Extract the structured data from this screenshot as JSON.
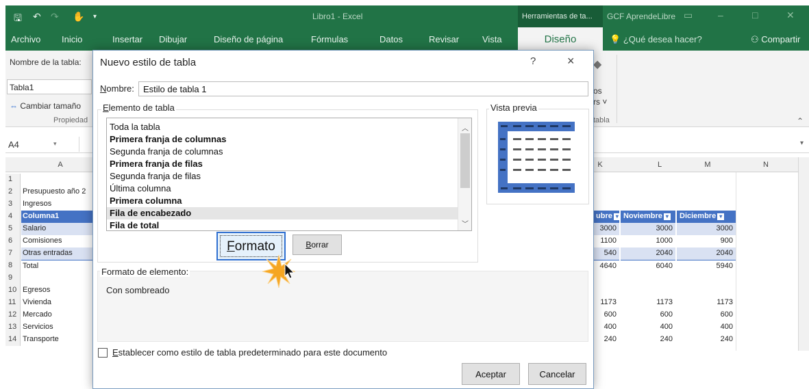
{
  "excel": {
    "document_title": "Libro1 - Excel",
    "context_tab": "Herramientas de ta...",
    "brand": "GCF AprendeLibre",
    "tabs": [
      "Archivo",
      "Inicio",
      "Insertar",
      "Dibujar",
      "Diseño de página",
      "Fórmulas",
      "Datos",
      "Revisar",
      "Vista"
    ],
    "active_tab": "Diseño",
    "tell_me": "¿Qué desea hacer?",
    "share": "Compartir",
    "ribbon": {
      "table_name_label": "Nombre de la tabla:",
      "table_name_value": "Tabla1",
      "resize_label": "Cambiar tamaño",
      "group_label": "Propiedad",
      "styles_group": "tabla",
      "partial_1": "os",
      "partial_2": "rs ˅"
    },
    "name_box": "A4",
    "columns": [
      "A",
      "K",
      "L",
      "M",
      "N"
    ],
    "rows": [
      {
        "n": "1",
        "a": ""
      },
      {
        "n": "2",
        "a": "Presupuesto año 2"
      },
      {
        "n": "3",
        "a": "Ingresos"
      },
      {
        "n": "4",
        "a": "Columna1"
      },
      {
        "n": "5",
        "a": "Salario"
      },
      {
        "n": "6",
        "a": "Comisiones"
      },
      {
        "n": "7",
        "a": "Otras entradas"
      },
      {
        "n": "8",
        "a": "Total"
      },
      {
        "n": "9",
        "a": ""
      },
      {
        "n": "10",
        "a": "Egresos"
      },
      {
        "n": "11",
        "a": "Vivienda"
      },
      {
        "n": "12",
        "a": "Mercado"
      },
      {
        "n": "13",
        "a": "Servicios"
      },
      {
        "n": "14",
        "a": "Transporte"
      }
    ],
    "right_headers": [
      "ubre",
      "Noviembre",
      "Diciembre"
    ],
    "right_values": [
      [
        "3000",
        "3000",
        "3000"
      ],
      [
        "1100",
        "1000",
        "900"
      ],
      [
        "540",
        "2040",
        "2040"
      ],
      [
        "4640",
        "6040",
        "5940"
      ],
      [
        "",
        "",
        ""
      ],
      [
        "",
        "",
        ""
      ],
      [
        "1173",
        "1173",
        "1173"
      ],
      [
        "600",
        "600",
        "600"
      ],
      [
        "400",
        "400",
        "400"
      ],
      [
        "240",
        "240",
        "240"
      ]
    ]
  },
  "dialog": {
    "title": "Nuevo estilo de tabla",
    "help": "?",
    "close": "×",
    "name_label_first": "N",
    "name_label_rest": "ombre:",
    "name_value": "Estilo de tabla 1",
    "element_label_first": "E",
    "element_label_rest": "lemento de tabla",
    "preview_label": "Vista previa",
    "elements": [
      {
        "label": "Toda la tabla",
        "bold": false
      },
      {
        "label": "Primera franja de columnas",
        "bold": true
      },
      {
        "label": "Segunda franja de columnas",
        "bold": false
      },
      {
        "label": "Primera franja de filas",
        "bold": true
      },
      {
        "label": "Segunda franja de filas",
        "bold": false
      },
      {
        "label": "Última columna",
        "bold": false
      },
      {
        "label": "Primera columna",
        "bold": true
      },
      {
        "label": "Fila de encabezado",
        "bold": true
      },
      {
        "label": "Fila de total",
        "bold": true
      }
    ],
    "selected_element": "Fila de encabezado",
    "format_button_first": "F",
    "format_button_rest": "ormato",
    "clear_button_first": "B",
    "clear_button_rest": "orrar",
    "element_format_label": "Formato de elemento:",
    "element_format_value": "Con sombreado",
    "default_checkbox_first": "E",
    "default_checkbox_rest": "stablecer como estilo de tabla predeterminado para este documento",
    "ok_button": "Aceptar",
    "cancel_button": "Cancelar"
  },
  "colors": {
    "excel_green": "#217346",
    "table_blue": "#4472c4",
    "band_blue": "#d9e1f2",
    "focus_blue": "#2f6fd0",
    "burst_orange": "#f5a623"
  }
}
